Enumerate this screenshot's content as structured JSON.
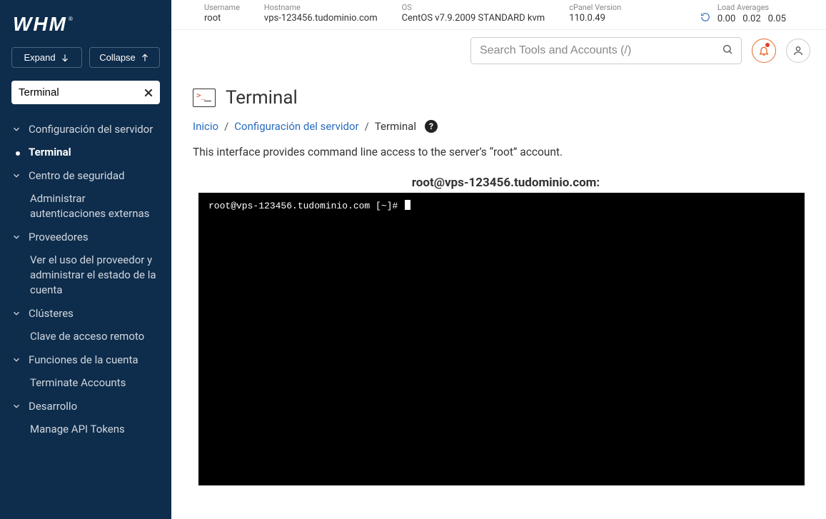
{
  "brand": "WHM",
  "sidebar": {
    "expand_label": "Expand",
    "collapse_label": "Collapse",
    "search_value": "Terminal",
    "groups": [
      {
        "label": "Configuración del servidor",
        "items": [
          "Terminal"
        ],
        "active_index": 0
      },
      {
        "label": "Centro de seguridad",
        "items": [
          "Administrar autenticaciones externas"
        ]
      },
      {
        "label": "Proveedores",
        "items": [
          "Ver el uso del proveedor y administrar el estado de la cuenta"
        ]
      },
      {
        "label": "Clústeres",
        "items": [
          "Clave de acceso remoto"
        ]
      },
      {
        "label": "Funciones de la cuenta",
        "items": [
          "Terminate Accounts"
        ]
      },
      {
        "label": "Desarrollo",
        "items": [
          "Manage API Tokens"
        ]
      }
    ]
  },
  "top": {
    "username_label": "Username",
    "username_value": "root",
    "hostname_label": "Hostname",
    "hostname_value": "vps-123456.tudominio.com",
    "os_label": "OS",
    "os_value": "CentOS v7.9.2009 STANDARD kvm",
    "cpanel_label": "cPanel Version",
    "cpanel_value": "110.0.49",
    "load_label": "Load Averages",
    "load1": "0.00",
    "load2": "0.02",
    "load3": "0.05",
    "search_placeholder": "Search Tools and Accounts (/)"
  },
  "page": {
    "title": "Terminal",
    "crumbs": {
      "home": "Inicio",
      "section": "Configuración del servidor",
      "leaf": "Terminal"
    },
    "description": "This interface provides command line access to the server’s “root” account.",
    "terminal_host": "root@vps-123456.tudominio.com:",
    "terminal_prompt": "root@vps-123456.tudominio.com [~]# "
  }
}
